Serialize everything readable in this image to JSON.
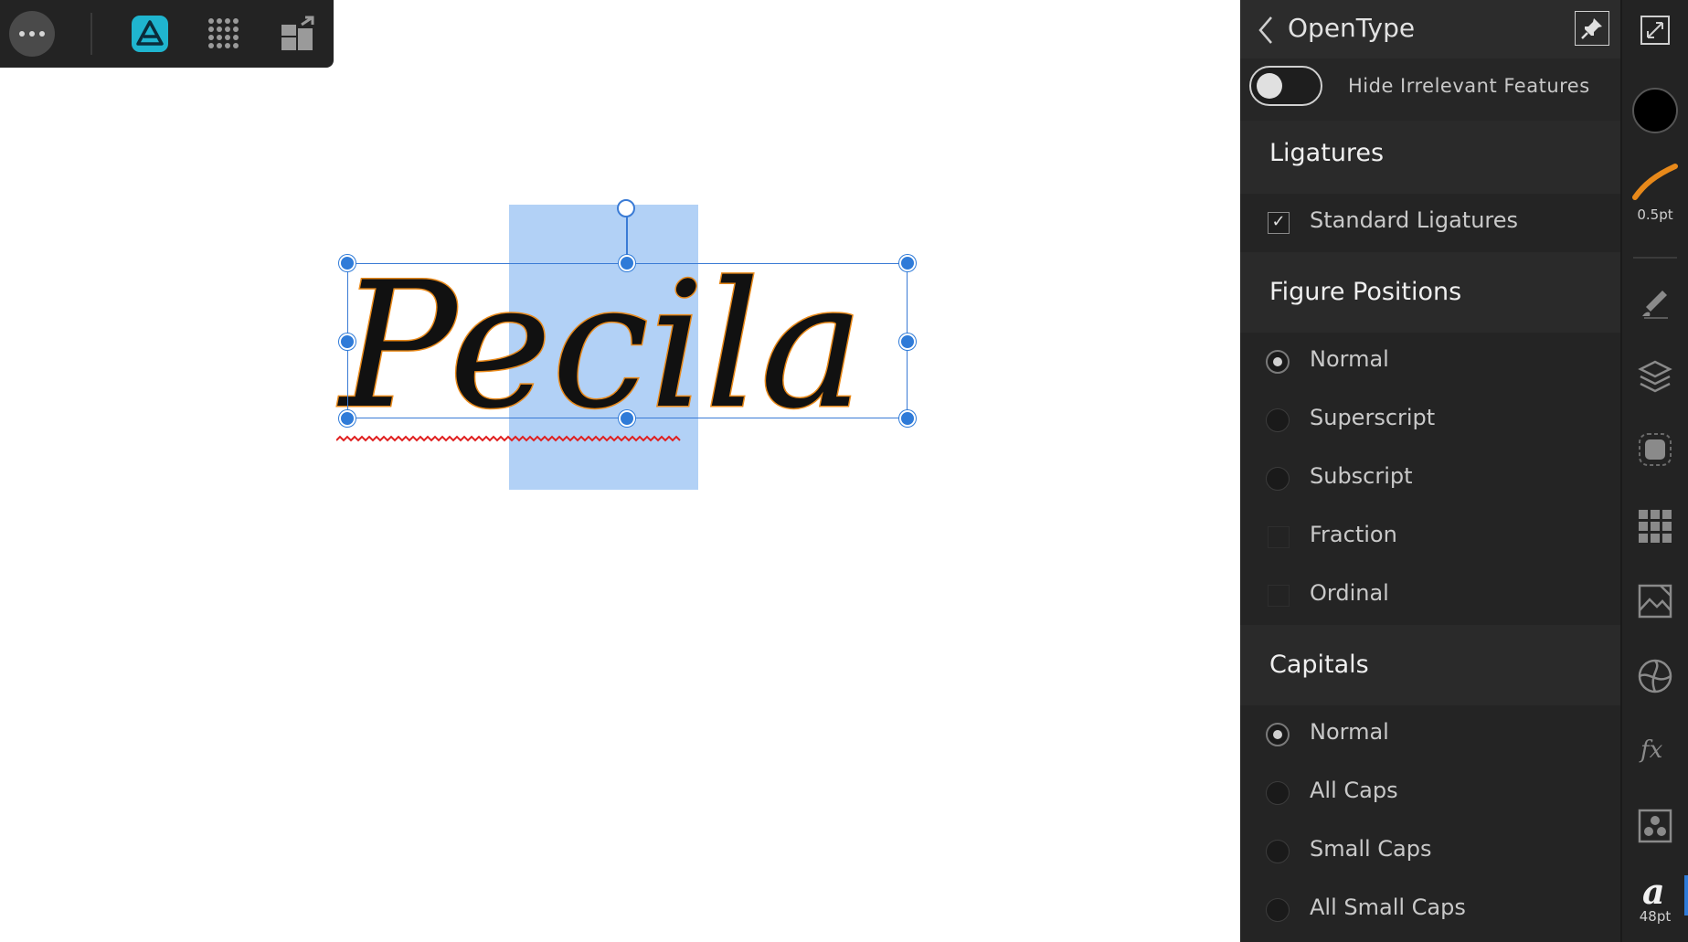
{
  "toolbar": {
    "more_icon": "ellipsis-icon",
    "app_icon": "affinity-designer-logo",
    "grid_icon": "dot-grid-icon",
    "persona_icon": "export-persona-icon"
  },
  "canvas": {
    "text": "Pecila",
    "text_color": "#111111",
    "text_stroke": "#e8891a",
    "selection_color": "#b2d1f6",
    "handle_color": "#2f7bd8",
    "spellcheck_color": "#e02020"
  },
  "panel": {
    "title": "OpenType",
    "hide_toggle_label": "Hide Irrelevant Features",
    "hide_toggle_on": false,
    "sections": {
      "ligatures": {
        "title": "Ligatures",
        "options": [
          {
            "label": "Standard Ligatures",
            "checked": true
          }
        ]
      },
      "figure_positions": {
        "title": "Figure Positions",
        "options": [
          {
            "label": "Normal",
            "selected": true
          },
          {
            "label": "Superscript",
            "selected": false
          },
          {
            "label": "Subscript",
            "selected": false
          },
          {
            "label": "Fraction",
            "selected": false
          },
          {
            "label": "Ordinal",
            "selected": false
          }
        ]
      },
      "capitals": {
        "title": "Capitals",
        "options": [
          {
            "label": "Normal",
            "selected": true
          },
          {
            "label": "All Caps",
            "selected": false
          },
          {
            "label": "Small Caps",
            "selected": false
          },
          {
            "label": "All Small Caps",
            "selected": false
          }
        ]
      }
    }
  },
  "tools": {
    "stroke_width": "0.5pt",
    "font_size": "48pt",
    "fill_color": "#000000",
    "stroke_color": "#e8891a",
    "items": [
      "fullscreen-icon",
      "fill-swatch",
      "stroke-brush",
      "brushes-icon",
      "layers-icon",
      "effects-icon",
      "swatches-grid-icon",
      "stock-image-icon",
      "color-wheel-icon",
      "fx-icon",
      "styles-icon",
      "character-icon"
    ]
  }
}
